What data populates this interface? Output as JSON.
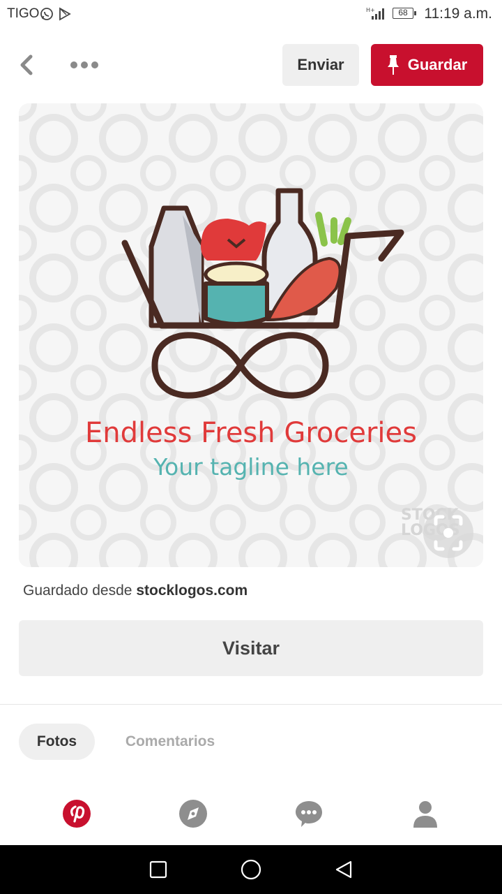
{
  "status_bar": {
    "carrier": "TIGO",
    "battery": "68",
    "time": "11:19 a.m."
  },
  "header": {
    "send_label": "Enviar",
    "save_label": "Guardar"
  },
  "pin": {
    "logo_title": "Endless Fresh Groceries",
    "logo_tagline": "Your tagline here",
    "watermark": "STOCK LOGOS",
    "source_prefix": "Guardado desde",
    "source_domain": "stocklogos.com"
  },
  "visit_label": "Visitar",
  "tabs": [
    {
      "label": "Fotos",
      "active": true
    },
    {
      "label": "Comentarios",
      "active": false
    }
  ],
  "bottom_nav": [
    {
      "icon": "pinterest-logo-icon",
      "active": true
    },
    {
      "icon": "compass-icon",
      "active": false
    },
    {
      "icon": "chat-bubble-icon",
      "active": false
    },
    {
      "icon": "profile-icon",
      "active": false
    }
  ],
  "colors": {
    "brand_red": "#c8102e",
    "button_gray": "#efefef",
    "logo_red": "#e03a3a",
    "logo_teal": "#55b3b0"
  }
}
